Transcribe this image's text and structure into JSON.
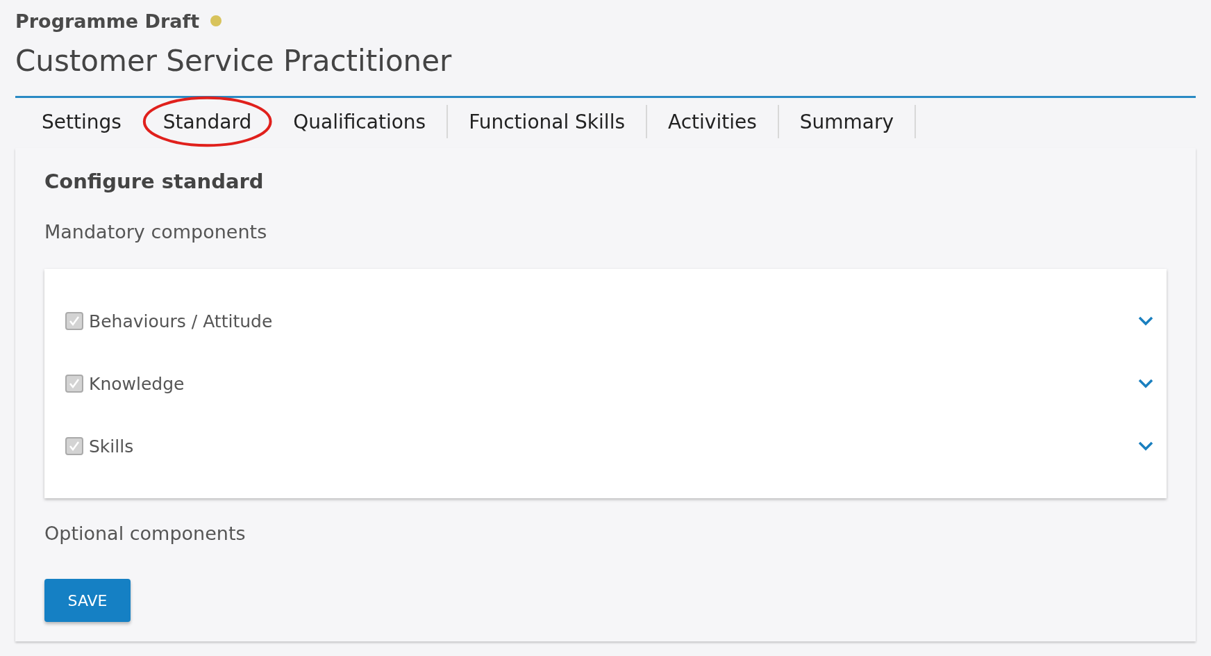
{
  "header": {
    "status": {
      "label": "Programme Draft",
      "color": "#d8c35c"
    },
    "title": "Customer Service Practitioner"
  },
  "tabs": [
    {
      "label": "Settings",
      "selected": false
    },
    {
      "label": "Standard",
      "selected": true
    },
    {
      "label": "Qualifications",
      "selected": false
    },
    {
      "label": "Functional Skills",
      "selected": false
    },
    {
      "label": "Activities",
      "selected": false
    },
    {
      "label": "Summary",
      "selected": false
    }
  ],
  "panel": {
    "heading": "Configure standard",
    "mandatory_label": "Mandatory components",
    "components": [
      {
        "label": "Behaviours / Attitude",
        "checked": true,
        "disabled": true
      },
      {
        "label": "Knowledge",
        "checked": true,
        "disabled": true
      },
      {
        "label": "Skills",
        "checked": true,
        "disabled": true
      }
    ],
    "optional_label": "Optional components",
    "save_button": "SAVE"
  }
}
